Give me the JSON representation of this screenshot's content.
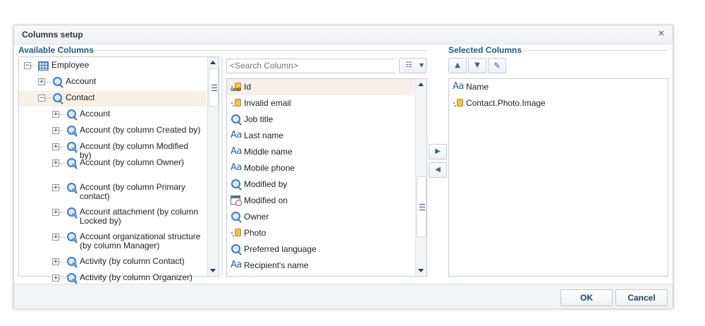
{
  "dialog": {
    "title": "Columns setup",
    "close_glyph": "×"
  },
  "available": {
    "heading": "Available Columns",
    "tree": [
      {
        "label": "Employee",
        "expander": "−",
        "icon": "table-icon"
      },
      {
        "label": "Account",
        "expander": "+",
        "icon": "lookup-icon"
      },
      {
        "label": "Contact",
        "expander": "−",
        "icon": "lookup-icon"
      },
      {
        "label": "Account",
        "expander": "+",
        "icon": "lookup-icon"
      },
      {
        "label": "Account (by column Created by)",
        "expander": "+",
        "icon": "lookup-user-icon"
      },
      {
        "label": "Account (by column Modified by)",
        "expander": "+",
        "icon": "lookup-user-icon"
      },
      {
        "label": "Account (by column Owner)",
        "expander": "+",
        "icon": "lookup-user-icon"
      },
      {
        "label": "Account (by column Primary contact)",
        "expander": "+",
        "icon": "lookup-user-icon"
      },
      {
        "label": "Account attachment (by column Locked by)",
        "expander": "+",
        "icon": "lookup-user-icon"
      },
      {
        "label": "Account organizational structure (by column Manager)",
        "expander": "+",
        "icon": "lookup-user-icon"
      },
      {
        "label": "Activity (by column Contact)",
        "expander": "+",
        "icon": "lookup-user-icon"
      },
      {
        "label": "Activity (by column Organizer)",
        "expander": "+",
        "icon": "lookup-user-icon"
      }
    ]
  },
  "columns": {
    "search_placeholder": "<Search Column>",
    "items": [
      {
        "label": "Id",
        "icon": "guid-icon"
      },
      {
        "label": "Invalid email",
        "icon": "boolean-icon"
      },
      {
        "label": "Job title",
        "icon": "lookup-icon"
      },
      {
        "label": "Last name",
        "icon": "text-icon"
      },
      {
        "label": "Middle name",
        "icon": "text-icon"
      },
      {
        "label": "Mobile phone",
        "icon": "text-icon"
      },
      {
        "label": "Modified by",
        "icon": "lookup-icon"
      },
      {
        "label": "Modified on",
        "icon": "datetime-icon"
      },
      {
        "label": "Owner",
        "icon": "lookup-icon"
      },
      {
        "label": "Photo",
        "icon": "image-icon"
      },
      {
        "label": "Preferred language",
        "icon": "lookup-icon"
      },
      {
        "label": "Recipient's name",
        "icon": "text-icon"
      }
    ]
  },
  "selected": {
    "heading": "Selected Columns",
    "items": [
      {
        "label": "Name",
        "icon": "text-icon"
      },
      {
        "label": "Contact.Photo.Image",
        "icon": "image-icon"
      }
    ]
  },
  "text_icon_glyph": "Aa",
  "footer": {
    "ok_label": "OK",
    "cancel_label": "Cancel"
  }
}
